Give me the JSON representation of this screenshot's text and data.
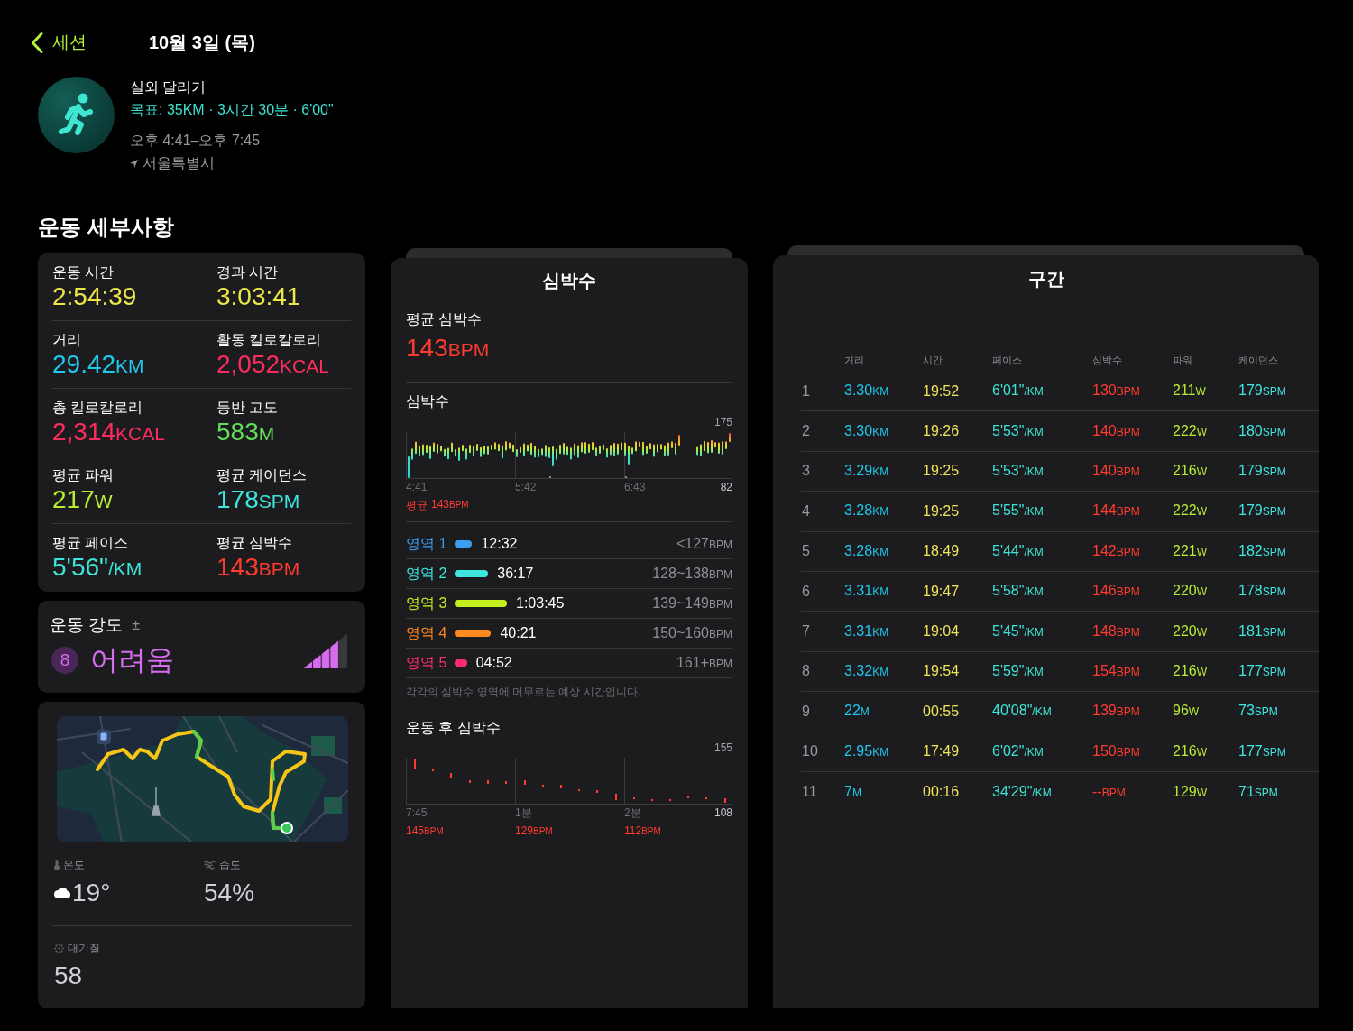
{
  "nav": {
    "back_label": "세션",
    "title": "10월 3일 (목)"
  },
  "workout": {
    "type": "실외 달리기",
    "goal": "목표: 35KM · 3시간 30분 · 6'00\"",
    "time_range": "오후 4:41–오후 7:45",
    "location": "서울특별시"
  },
  "details_title": "운동 세부사항",
  "metrics": [
    {
      "label": "운동 시간",
      "value": "2:54:39",
      "color": "#ebe64a"
    },
    {
      "label": "경과 시간",
      "value": "3:03:41",
      "color": "#ebe64a"
    },
    {
      "label": "거리",
      "value": "29.42",
      "unit": "KM",
      "color": "#1fc8ec"
    },
    {
      "label": "활동 킬로칼로리",
      "value": "2,052",
      "unit": "KCAL",
      "color": "#fb2d5e"
    },
    {
      "label": "총 킬로칼로리",
      "value": "2,314",
      "unit": "KCAL",
      "color": "#fb2d5e"
    },
    {
      "label": "등반 고도",
      "value": "583",
      "unit": "M",
      "color": "#62dd59"
    },
    {
      "label": "평균 파워",
      "value": "217",
      "unit": "W",
      "color": "#b7ef30"
    },
    {
      "label": "평균 케이던스",
      "value": "178",
      "unit": "SPM",
      "color": "#3fe6e0"
    },
    {
      "label": "평균 페이스",
      "value": "5'56\"",
      "unit": "/KM",
      "color": "#3de5d8"
    },
    {
      "label": "평균 심박수",
      "value": "143",
      "unit": "BPM",
      "color": "#ff3b30"
    }
  ],
  "effort": {
    "title": "운동 강도",
    "adjust_symbol": "±",
    "score": "8",
    "rating": "어려움"
  },
  "weather": [
    {
      "kind": "temperature",
      "label": "온도",
      "value": "19°"
    },
    {
      "kind": "humidity",
      "label": "습도",
      "value": "54%"
    },
    {
      "kind": "air_quality",
      "label": "대기질",
      "value": "58"
    }
  ],
  "heart_rate": {
    "title": "심박수",
    "average": {
      "label": "평균 심박수",
      "value": "143",
      "unit": "BPM"
    },
    "chart": {
      "title": "심박수",
      "y_max": "175",
      "y_min": "82",
      "x_labels": [
        "4:41",
        "5:42",
        "6:43"
      ],
      "average": {
        "label": "평균",
        "value": "143",
        "unit": "BPM"
      }
    },
    "zones": [
      {
        "label": "영역 1",
        "color": "#3a9ef5",
        "time": "12:32",
        "range": "<127",
        "unit": "BPM"
      },
      {
        "label": "영역 2",
        "color": "#3ee6e0",
        "time": "36:17",
        "range": "128~138",
        "unit": "BPM"
      },
      {
        "label": "영역 3",
        "color": "#c4f01f",
        "time": "1:03:45",
        "range": "139~149",
        "unit": "BPM"
      },
      {
        "label": "영역 4",
        "color": "#ff8a1f",
        "time": "40:21",
        "range": "150~160",
        "unit": "BPM"
      },
      {
        "label": "영역 5",
        "color": "#ff2d6f",
        "time": "04:52",
        "range": "161+",
        "unit": "BPM"
      }
    ],
    "zones_note": "각각의 심박수 영역에 머무르는 예상 시간입니다.",
    "recovery": {
      "title": "운동 후 심박수",
      "y_max": "155",
      "y_min": "108",
      "x_labels": [
        "7:45",
        "1분",
        "2분"
      ],
      "readings": [
        {
          "value": "145",
          "unit": "BPM"
        },
        {
          "value": "129",
          "unit": "BPM"
        },
        {
          "value": "112",
          "unit": "BPM"
        }
      ]
    }
  },
  "splits": {
    "title": "구간",
    "columns": [
      "거리",
      "시간",
      "페이스",
      "심박수",
      "파워",
      "케이던스"
    ],
    "rows": [
      {
        "number": "1",
        "cells": [
          {
            "value": "3.30",
            "unit": "KM"
          },
          {
            "value": "19:52"
          },
          {
            "value": "6'01\"",
            "unit": "/KM"
          },
          {
            "value": "130",
            "unit": "BPM"
          },
          {
            "value": "211",
            "unit": "W"
          },
          {
            "value": "179",
            "unit": "SPM"
          }
        ]
      },
      {
        "number": "2",
        "cells": [
          {
            "value": "3.30",
            "unit": "KM"
          },
          {
            "value": "19:26"
          },
          {
            "value": "5'53\"",
            "unit": "/KM"
          },
          {
            "value": "140",
            "unit": "BPM"
          },
          {
            "value": "222",
            "unit": "W"
          },
          {
            "value": "180",
            "unit": "SPM"
          }
        ]
      },
      {
        "number": "3",
        "cells": [
          {
            "value": "3.29",
            "unit": "KM"
          },
          {
            "value": "19:25"
          },
          {
            "value": "5'53\"",
            "unit": "/KM"
          },
          {
            "value": "140",
            "unit": "BPM"
          },
          {
            "value": "216",
            "unit": "W"
          },
          {
            "value": "179",
            "unit": "SPM"
          }
        ]
      },
      {
        "number": "4",
        "cells": [
          {
            "value": "3.28",
            "unit": "KM"
          },
          {
            "value": "19:25"
          },
          {
            "value": "5'55\"",
            "unit": "/KM"
          },
          {
            "value": "144",
            "unit": "BPM"
          },
          {
            "value": "222",
            "unit": "W"
          },
          {
            "value": "179",
            "unit": "SPM"
          }
        ]
      },
      {
        "number": "5",
        "cells": [
          {
            "value": "3.28",
            "unit": "KM"
          },
          {
            "value": "18:49"
          },
          {
            "value": "5'44\"",
            "unit": "/KM"
          },
          {
            "value": "142",
            "unit": "BPM"
          },
          {
            "value": "221",
            "unit": "W"
          },
          {
            "value": "182",
            "unit": "SPM"
          }
        ]
      },
      {
        "number": "6",
        "cells": [
          {
            "value": "3.31",
            "unit": "KM"
          },
          {
            "value": "19:47"
          },
          {
            "value": "5'58\"",
            "unit": "/KM"
          },
          {
            "value": "146",
            "unit": "BPM"
          },
          {
            "value": "220",
            "unit": "W"
          },
          {
            "value": "178",
            "unit": "SPM"
          }
        ]
      },
      {
        "number": "7",
        "cells": [
          {
            "value": "3.31",
            "unit": "KM"
          },
          {
            "value": "19:04"
          },
          {
            "value": "5'45\"",
            "unit": "/KM"
          },
          {
            "value": "148",
            "unit": "BPM"
          },
          {
            "value": "220",
            "unit": "W"
          },
          {
            "value": "181",
            "unit": "SPM"
          }
        ]
      },
      {
        "number": "8",
        "cells": [
          {
            "value": "3.32",
            "unit": "KM"
          },
          {
            "value": "19:54"
          },
          {
            "value": "5'59\"",
            "unit": "/KM"
          },
          {
            "value": "154",
            "unit": "BPM"
          },
          {
            "value": "216",
            "unit": "W"
          },
          {
            "value": "177",
            "unit": "SPM"
          }
        ]
      },
      {
        "number": "9",
        "cells": [
          {
            "value": "22",
            "unit": "M"
          },
          {
            "value": "00:55"
          },
          {
            "value": "40'08\"",
            "unit": "/KM"
          },
          {
            "value": "139",
            "unit": "BPM"
          },
          {
            "value": "96",
            "unit": "W"
          },
          {
            "value": "73",
            "unit": "SPM"
          }
        ]
      },
      {
        "number": "10",
        "cells": [
          {
            "value": "2.95",
            "unit": "KM"
          },
          {
            "value": "17:49"
          },
          {
            "value": "6'02\"",
            "unit": "/KM"
          },
          {
            "value": "150",
            "unit": "BPM"
          },
          {
            "value": "216",
            "unit": "W"
          },
          {
            "value": "177",
            "unit": "SPM"
          }
        ]
      },
      {
        "number": "11",
        "cells": [
          {
            "value": "7",
            "unit": "M"
          },
          {
            "value": "00:16"
          },
          {
            "value": "34'29\"",
            "unit": "/KM"
          },
          {
            "value": "--",
            "unit": "BPM"
          },
          {
            "value": "129",
            "unit": "W"
          },
          {
            "value": "71",
            "unit": "SPM"
          }
        ]
      }
    ]
  }
}
